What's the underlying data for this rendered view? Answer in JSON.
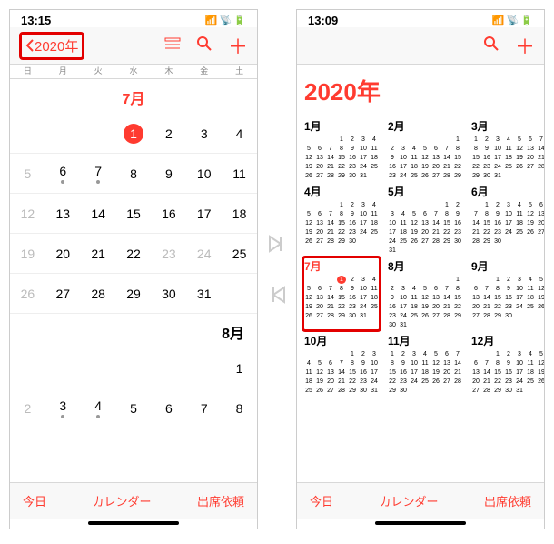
{
  "left": {
    "time": "13:15",
    "back_label": "2020年",
    "dow": [
      "日",
      "月",
      "火",
      "水",
      "木",
      "金",
      "土"
    ],
    "july_label": "7月",
    "august_label": "8月",
    "july_days": [
      {
        "d": "",
        "gray": false
      },
      {
        "d": "",
        "gray": false
      },
      {
        "d": "",
        "gray": false
      },
      {
        "d": "1",
        "today": true
      },
      {
        "d": "2"
      },
      {
        "d": "3"
      },
      {
        "d": "4"
      },
      {
        "d": "5",
        "gray": true
      },
      {
        "d": "6",
        "dot": true
      },
      {
        "d": "7",
        "dot": true
      },
      {
        "d": "8"
      },
      {
        "d": "9"
      },
      {
        "d": "10"
      },
      {
        "d": "11"
      },
      {
        "d": "12",
        "gray": true
      },
      {
        "d": "13"
      },
      {
        "d": "14"
      },
      {
        "d": "15"
      },
      {
        "d": "16"
      },
      {
        "d": "17"
      },
      {
        "d": "18"
      },
      {
        "d": "19",
        "gray": true
      },
      {
        "d": "20"
      },
      {
        "d": "21"
      },
      {
        "d": "22"
      },
      {
        "d": "23",
        "gray": true
      },
      {
        "d": "24",
        "gray": true
      },
      {
        "d": "25"
      },
      {
        "d": "26",
        "gray": true
      },
      {
        "d": "27"
      },
      {
        "d": "28"
      },
      {
        "d": "29"
      },
      {
        "d": "30"
      },
      {
        "d": "31"
      },
      {
        "d": ""
      }
    ],
    "aug_days": [
      {
        "d": ""
      },
      {
        "d": ""
      },
      {
        "d": ""
      },
      {
        "d": ""
      },
      {
        "d": ""
      },
      {
        "d": ""
      },
      {
        "d": "1"
      },
      {
        "d": "2",
        "gray": true
      },
      {
        "d": "3",
        "dot": true
      },
      {
        "d": "4",
        "dot": true
      },
      {
        "d": "5"
      },
      {
        "d": "6"
      },
      {
        "d": "7"
      },
      {
        "d": "8"
      }
    ],
    "footer": {
      "today": "今日",
      "cal": "カレンダー",
      "inbox": "出席依頼"
    }
  },
  "right": {
    "time": "13:09",
    "year_label": "2020年",
    "months": [
      {
        "name": "1月",
        "first_dow": 3,
        "days": 31
      },
      {
        "name": "2月",
        "first_dow": 6,
        "days": 29
      },
      {
        "name": "3月",
        "first_dow": 0,
        "days": 31
      },
      {
        "name": "4月",
        "first_dow": 3,
        "days": 30
      },
      {
        "name": "5月",
        "first_dow": 5,
        "days": 31
      },
      {
        "name": "6月",
        "first_dow": 1,
        "days": 30
      },
      {
        "name": "7月",
        "first_dow": 3,
        "days": 31,
        "current": true,
        "today": 1
      },
      {
        "name": "8月",
        "first_dow": 6,
        "days": 31
      },
      {
        "name": "9月",
        "first_dow": 2,
        "days": 30
      },
      {
        "name": "10月",
        "first_dow": 4,
        "days": 31
      },
      {
        "name": "11月",
        "first_dow": 0,
        "days": 30
      },
      {
        "name": "12月",
        "first_dow": 2,
        "days": 31
      }
    ],
    "footer": {
      "today": "今日",
      "cal": "カレンダー",
      "inbox": "出席依頼"
    }
  }
}
